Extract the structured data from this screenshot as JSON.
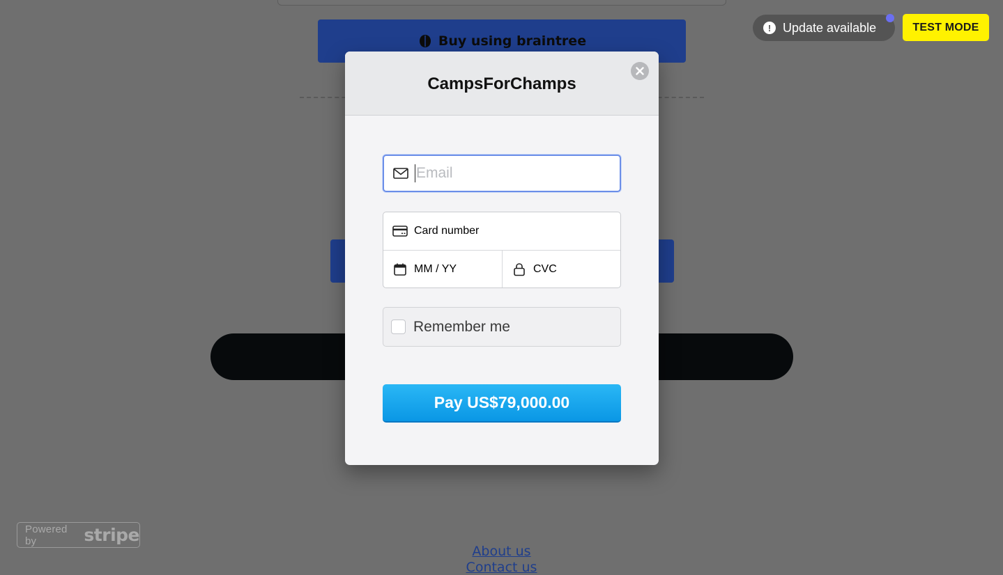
{
  "background": {
    "braintree_button_label": "Buy using braintree",
    "footer_links": [
      "About us",
      "Contact us"
    ]
  },
  "stripe_badge": {
    "powered_by": "Powered by",
    "brand": "stripe"
  },
  "update_notice": {
    "label": "Update available",
    "icon": "alert-icon"
  },
  "test_mode": {
    "label": "TEST MODE"
  },
  "checkout": {
    "title": "CampsForChamps",
    "email_placeholder": "Email",
    "card_number_placeholder": "Card number",
    "expiry_placeholder": "MM / YY",
    "cvc_placeholder": "CVC",
    "remember_label": "Remember me",
    "remember_checked": false,
    "pay_button_label": "Pay US$79,000.00"
  },
  "colors": {
    "overlay": "#6f6f6f",
    "pay_button": "#0a97e5",
    "email_focus": "#6b8ee8",
    "test_mode_bg": "#fff200",
    "braintree_bg": "#1f3e8c"
  }
}
